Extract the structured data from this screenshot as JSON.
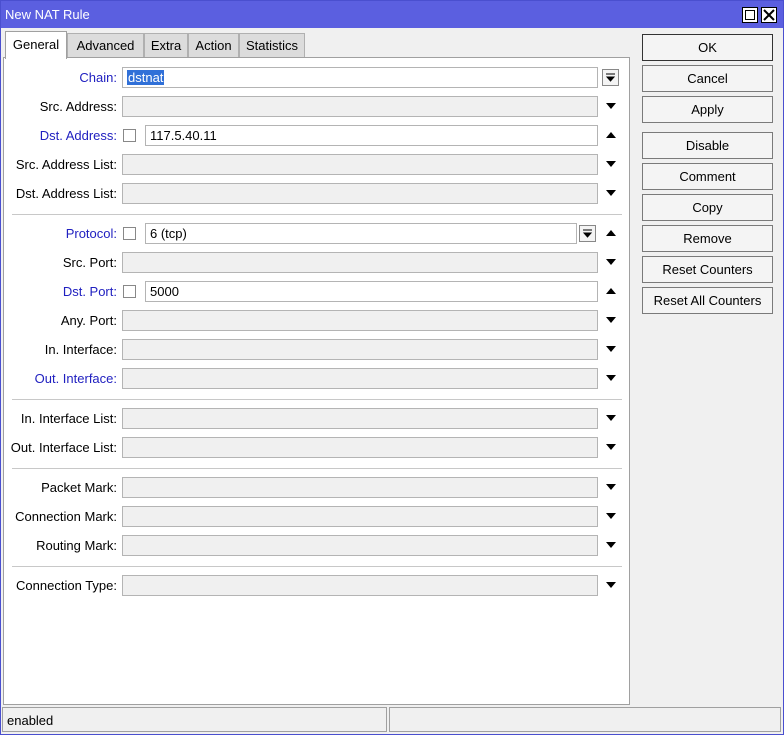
{
  "window": {
    "title": "New NAT Rule"
  },
  "tabs": [
    "General",
    "Advanced",
    "Extra",
    "Action",
    "Statistics"
  ],
  "fields": {
    "chain": {
      "label": "Chain:",
      "value": "dstnat"
    },
    "src_address": {
      "label": "Src. Address:"
    },
    "dst_address": {
      "label": "Dst. Address:",
      "value": "117.5.40.11"
    },
    "src_address_list": {
      "label": "Src. Address List:"
    },
    "dst_address_list": {
      "label": "Dst. Address List:"
    },
    "protocol": {
      "label": "Protocol:",
      "value": "6 (tcp)"
    },
    "src_port": {
      "label": "Src. Port:"
    },
    "dst_port": {
      "label": "Dst. Port:",
      "value": "5000"
    },
    "any_port": {
      "label": "Any. Port:"
    },
    "in_interface": {
      "label": "In. Interface:"
    },
    "out_interface": {
      "label": "Out. Interface:"
    },
    "in_interface_list": {
      "label": "In. Interface List:"
    },
    "out_interface_list": {
      "label": "Out. Interface List:"
    },
    "packet_mark": {
      "label": "Packet Mark:"
    },
    "connection_mark": {
      "label": "Connection Mark:"
    },
    "routing_mark": {
      "label": "Routing Mark:"
    },
    "connection_type": {
      "label": "Connection Type:"
    }
  },
  "buttons": {
    "ok": "OK",
    "cancel": "Cancel",
    "apply": "Apply",
    "disable": "Disable",
    "comment": "Comment",
    "copy": "Copy",
    "remove": "Remove",
    "reset_counters": "Reset Counters",
    "reset_all_counters": "Reset All Counters"
  },
  "status": {
    "state": "enabled"
  },
  "colors": {
    "titlebar": "#5b5fe0",
    "label_link": "#2020c0",
    "selection": "#3070d8"
  }
}
